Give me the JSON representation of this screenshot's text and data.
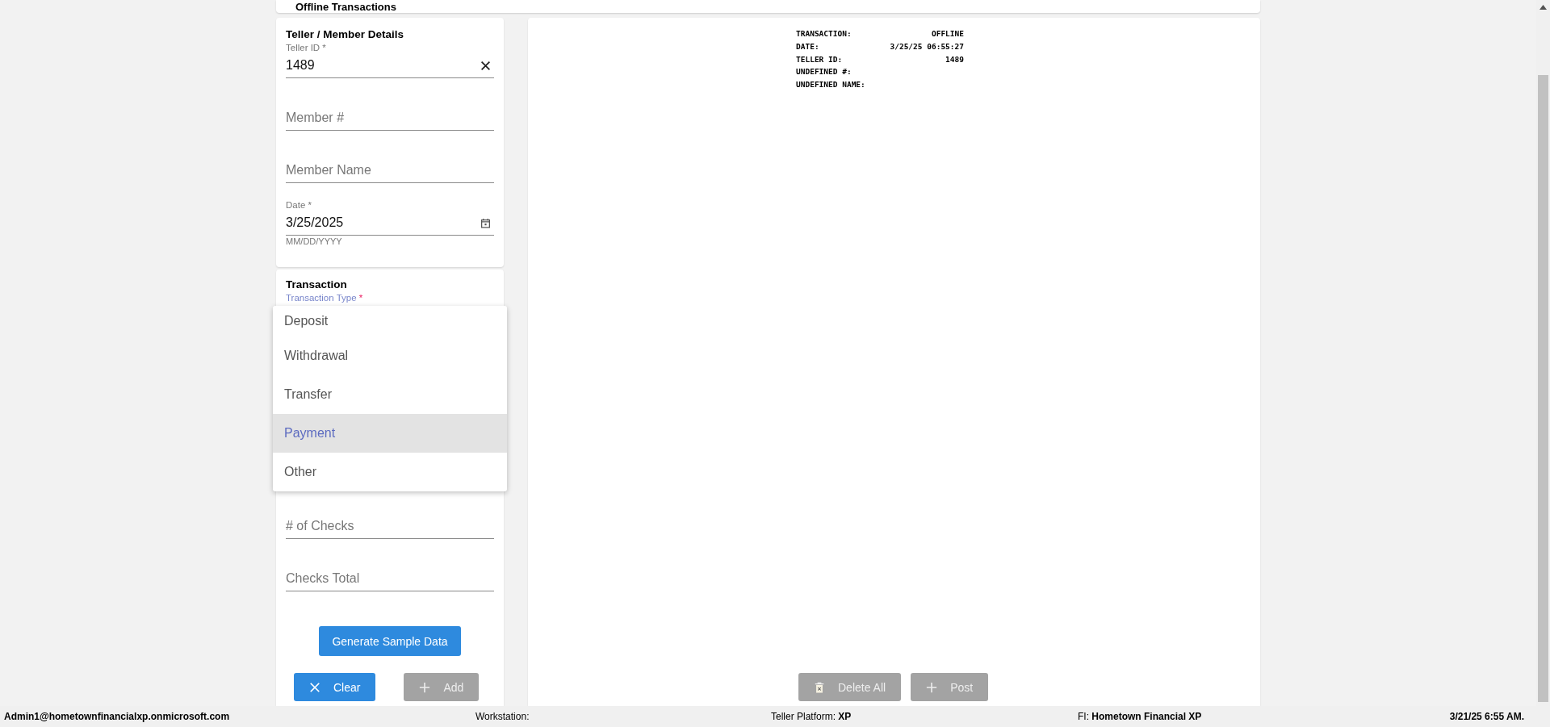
{
  "header": {
    "title": "Offline Transactions"
  },
  "details": {
    "title": "Teller / Member Details",
    "fields": [
      {
        "kind": "clearable",
        "label": "Teller ID *",
        "value": "1489"
      },
      {
        "label": "Member #"
      },
      {
        "label": "Member Name"
      },
      {
        "kind": "date",
        "label": "Date *",
        "value": "3/25/2025",
        "hint": "MM/DD/YYYY"
      }
    ]
  },
  "transaction": {
    "title": "Transaction",
    "type_field": {
      "label": "Transaction Type",
      "mark": "*",
      "focused": true
    },
    "menu": [
      {
        "label": "Deposit",
        "selected": false
      },
      {
        "label": "Withdrawal",
        "selected": false
      },
      {
        "label": "Transfer",
        "selected": false
      },
      {
        "label": "Payment",
        "selected": true
      },
      {
        "label": "Other",
        "selected": false
      }
    ],
    "fields": [
      {
        "label": "# of Checks"
      },
      {
        "label": "Checks Total"
      }
    ],
    "generate_button": {
      "label": "Generate Sample Data"
    },
    "buttons": [
      {
        "label": "Clear",
        "kind": "clear",
        "disabled": false
      },
      {
        "label": "Add",
        "kind": "add",
        "disabled": true
      }
    ]
  },
  "receipt": {
    "lines": [
      {
        "label": "TRANSACTION:",
        "value": "OFFLINE"
      },
      {
        "label": "DATE:",
        "value": "3/25/25 06:55:27"
      },
      {
        "label": "TELLER ID:",
        "value": "1489"
      },
      {
        "label": "UNDEFINED #:"
      },
      {
        "label": "UNDEFINED NAME:"
      }
    ],
    "buttons": [
      {
        "label": "Delete All",
        "kind": "delete",
        "disabled": true
      },
      {
        "label": "Post",
        "kind": "add",
        "disabled": true
      }
    ]
  },
  "status_bar": {
    "user": "Admin1@hometownfinancialxp.onmicrosoft.com",
    "workstation": "Workstation:",
    "platform": "Teller Platform: **XP**",
    "fi": "FI: **Hometown Financial XP**",
    "time": "3/21/25 6:55 AM."
  }
}
